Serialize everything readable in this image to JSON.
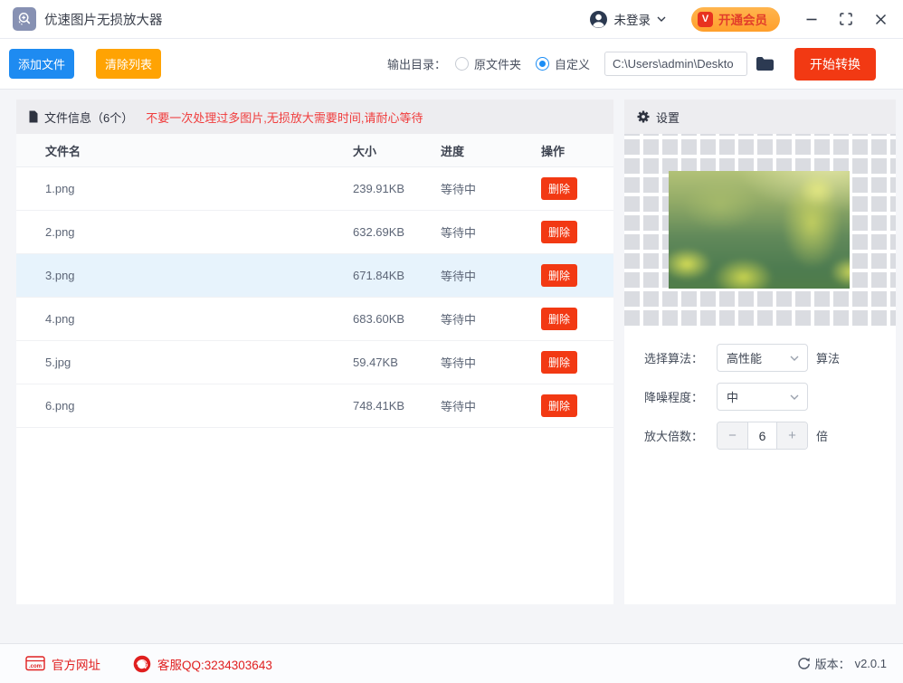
{
  "colors": {
    "accent_blue": "#1e8bf1",
    "accent_orange": "#ffa303",
    "accent_red": "#f23913",
    "vip_orange": "#ffa83d",
    "vip_text_red": "#e23d2a",
    "selected_row_blue": "#e7f3fc",
    "footer_link_red": "#e02020",
    "panel_header_gray": "#ededf0"
  },
  "titlebar": {
    "app_title": "优速图片无损放大器",
    "login_label": "未登录",
    "vip_badge": "V",
    "vip_label": "开通会员"
  },
  "toolbar": {
    "add_files": "添加文件",
    "clear_list": "清除列表",
    "output_dir_label": "输出目录：",
    "radio_original": "原文件夹",
    "radio_custom": "自定义",
    "path_value": "C:\\Users\\admin\\Deskto",
    "start_label": "开始转换"
  },
  "file_panel": {
    "title": "文件信息（6个）",
    "warning": "不要一次处理过多图片,无损放大需要时间,请耐心等待",
    "headers": [
      "文件名",
      "大小",
      "进度",
      "操作"
    ],
    "rows": [
      {
        "name": "1.png",
        "size": "239.91KB",
        "status": "等待中",
        "action": "删除"
      },
      {
        "name": "2.png",
        "size": "632.69KB",
        "status": "等待中",
        "action": "删除"
      },
      {
        "name": "3.png",
        "size": "671.84KB",
        "status": "等待中",
        "action": "删除"
      },
      {
        "name": "4.png",
        "size": "683.60KB",
        "status": "等待中",
        "action": "删除"
      },
      {
        "name": "5.jpg",
        "size": "59.47KB",
        "status": "等待中",
        "action": "删除"
      },
      {
        "name": "6.png",
        "size": "748.41KB",
        "status": "等待中",
        "action": "删除"
      }
    ]
  },
  "settings_panel": {
    "title": "设置",
    "algorithm_label": "选择算法：",
    "algorithm_value": "高性能",
    "algorithm_suffix": "算法",
    "denoise_label": "降噪程度：",
    "denoise_value": "中",
    "scale_label": "放大倍数：",
    "scale_minus": "−",
    "scale_value": "6",
    "scale_plus": "+",
    "scale_suffix": "倍"
  },
  "footer": {
    "website_label": "官方网址",
    "qq_label": "客服QQ:3234303643",
    "version_label": "版本：",
    "version_value": "v2.0.1"
  }
}
